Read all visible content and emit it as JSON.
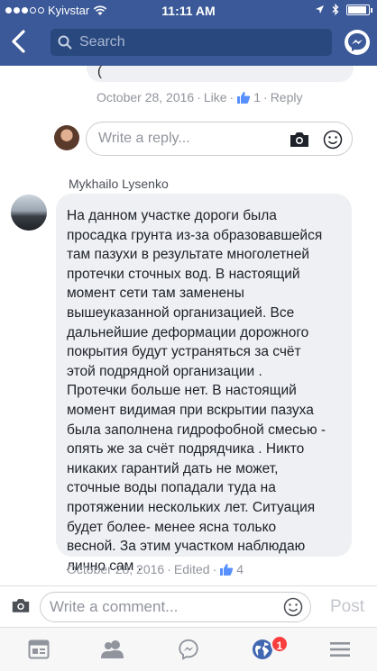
{
  "status_bar": {
    "carrier": "Kyivstar",
    "time": "11:11 AM",
    "battery_level": 0.92
  },
  "nav": {
    "search_placeholder": "Search"
  },
  "previous_reply": {
    "text_fragment": "(",
    "date": "October 28, 2016",
    "like_label": "Like",
    "like_count": "1",
    "reply_label": "Reply"
  },
  "reply_box": {
    "placeholder": "Write a reply..."
  },
  "comment": {
    "author": "Mykhailo Lysenko",
    "text": "На данном участке дороги была\nпросадка грунта из-за образовавшейся\nтам пазухи в результате многолетней\nпротечки сточных вод. В настоящий\nмомент сети там заменены\nвышеуказанной организацией. Все\nдальнейшие деформации дорожного\nпокрытия будут устраняться за счёт\nэтой подрядной организации .\nПротечки больше нет. В настоящий\nмомент видимая при вскрытии пазуха\nбыла заполнена гидрофобной смесью -\nопять же за счёт подрядчика . Никто\nникаких гарантий дать не может,\nсточные воды попадали туда на\nпротяжении нескольких лет. Ситуация\nбудет более- менее ясна только\nвесной. За этим участком наблюдаю\nлично сам .",
    "date": "October 28, 2016",
    "edited_label": "Edited",
    "like_count": "4"
  },
  "comment_bar": {
    "placeholder": "Write a comment...",
    "post_label": "Post"
  },
  "tab_bar": {
    "notifications_badge": "1"
  },
  "colors": {
    "brand": "#3b5998",
    "link": "#90949c",
    "badge": "#fa3e3e"
  }
}
